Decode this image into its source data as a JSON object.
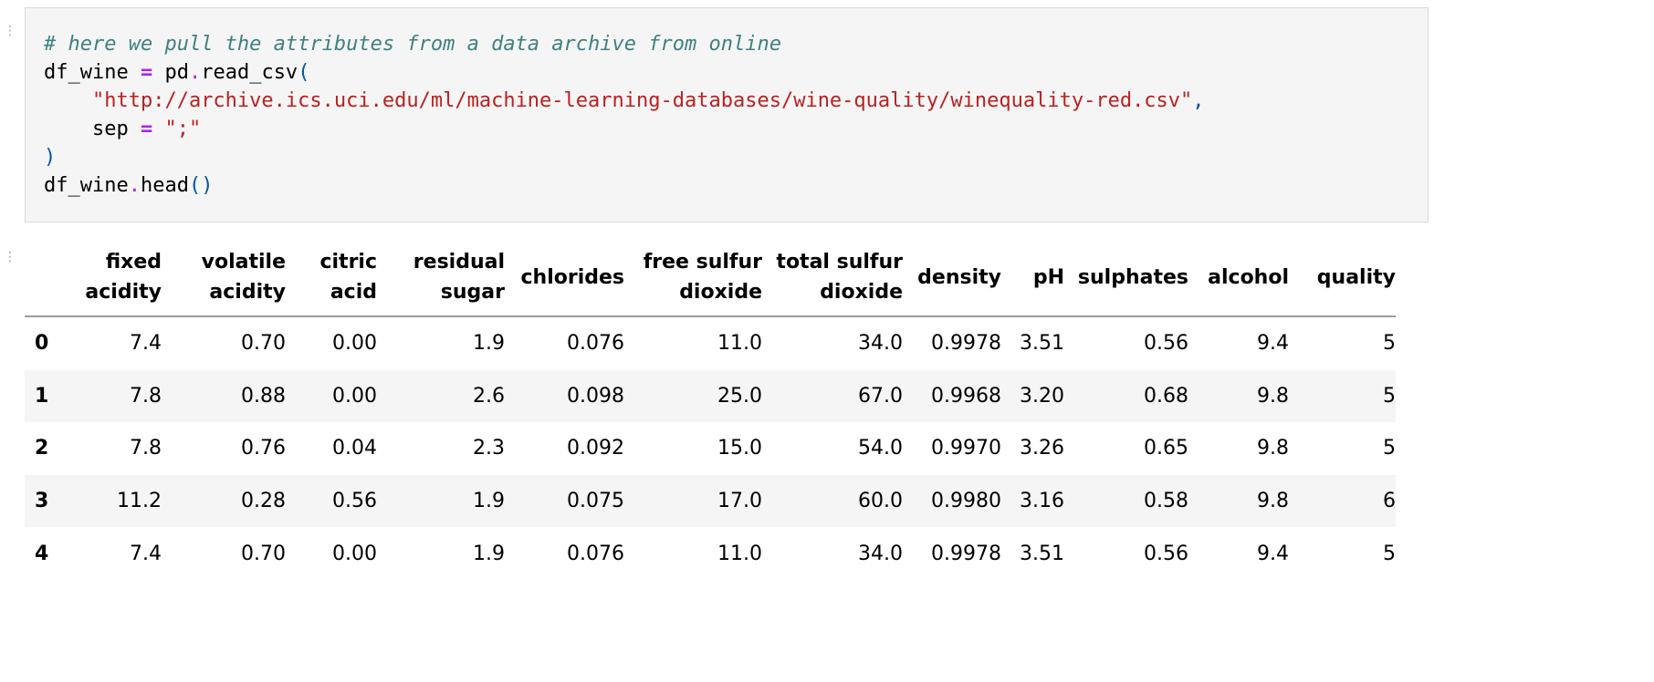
{
  "code_cell": {
    "comment": "# here we pull the attributes from a data archive from online",
    "var_name": "df_wine",
    "assign_op": "=",
    "module": "pd",
    "dot": ".",
    "func": "read_csv",
    "open_paren": "(",
    "url": "\"http://archive.ics.uci.edu/ml/machine-learning-databases/wine-quality/winequality-red.csv\"",
    "comma": ",",
    "sep_name": "sep",
    "sep_value": "\";\"",
    "close_paren": ")",
    "method": "head",
    "call_parens": "()"
  },
  "dataframe": {
    "columns": [
      {
        "line1": "fixed",
        "line2": "acidity"
      },
      {
        "line1": "volatile",
        "line2": "acidity"
      },
      {
        "line1": "citric",
        "line2": "acid"
      },
      {
        "line1": "residual",
        "line2": "sugar"
      },
      {
        "line1": "chlorides",
        "line2": ""
      },
      {
        "line1": "free sulfur",
        "line2": "dioxide"
      },
      {
        "line1": "total sulfur",
        "line2": "dioxide"
      },
      {
        "line1": "density",
        "line2": ""
      },
      {
        "line1": "pH",
        "line2": ""
      },
      {
        "line1": "sulphates",
        "line2": ""
      },
      {
        "line1": "alcohol",
        "line2": ""
      },
      {
        "line1": "quality",
        "line2": ""
      }
    ],
    "rows": [
      {
        "index": "0",
        "cells": [
          "7.4",
          "0.70",
          "0.00",
          "1.9",
          "0.076",
          "11.0",
          "34.0",
          "0.9978",
          "3.51",
          "0.56",
          "9.4",
          "5"
        ]
      },
      {
        "index": "1",
        "cells": [
          "7.8",
          "0.88",
          "0.00",
          "2.6",
          "0.098",
          "25.0",
          "67.0",
          "0.9968",
          "3.20",
          "0.68",
          "9.8",
          "5"
        ]
      },
      {
        "index": "2",
        "cells": [
          "7.8",
          "0.76",
          "0.04",
          "2.3",
          "0.092",
          "15.0",
          "54.0",
          "0.9970",
          "3.26",
          "0.65",
          "9.8",
          "5"
        ]
      },
      {
        "index": "3",
        "cells": [
          "11.2",
          "0.28",
          "0.56",
          "1.9",
          "0.075",
          "17.0",
          "60.0",
          "0.9980",
          "3.16",
          "0.58",
          "9.8",
          "6"
        ]
      },
      {
        "index": "4",
        "cells": [
          "7.4",
          "0.70",
          "0.00",
          "1.9",
          "0.076",
          "11.0",
          "34.0",
          "0.9978",
          "3.51",
          "0.56",
          "9.4",
          "5"
        ]
      }
    ]
  },
  "icons": {
    "collapser": "drag-handle-icon"
  },
  "colors": {
    "code_background": "#f5f5f5",
    "comment": "#408080",
    "operator": "#aa22ff",
    "string": "#ba2121",
    "paren": "#0055aa",
    "row_stripe": "#f5f5f5"
  }
}
